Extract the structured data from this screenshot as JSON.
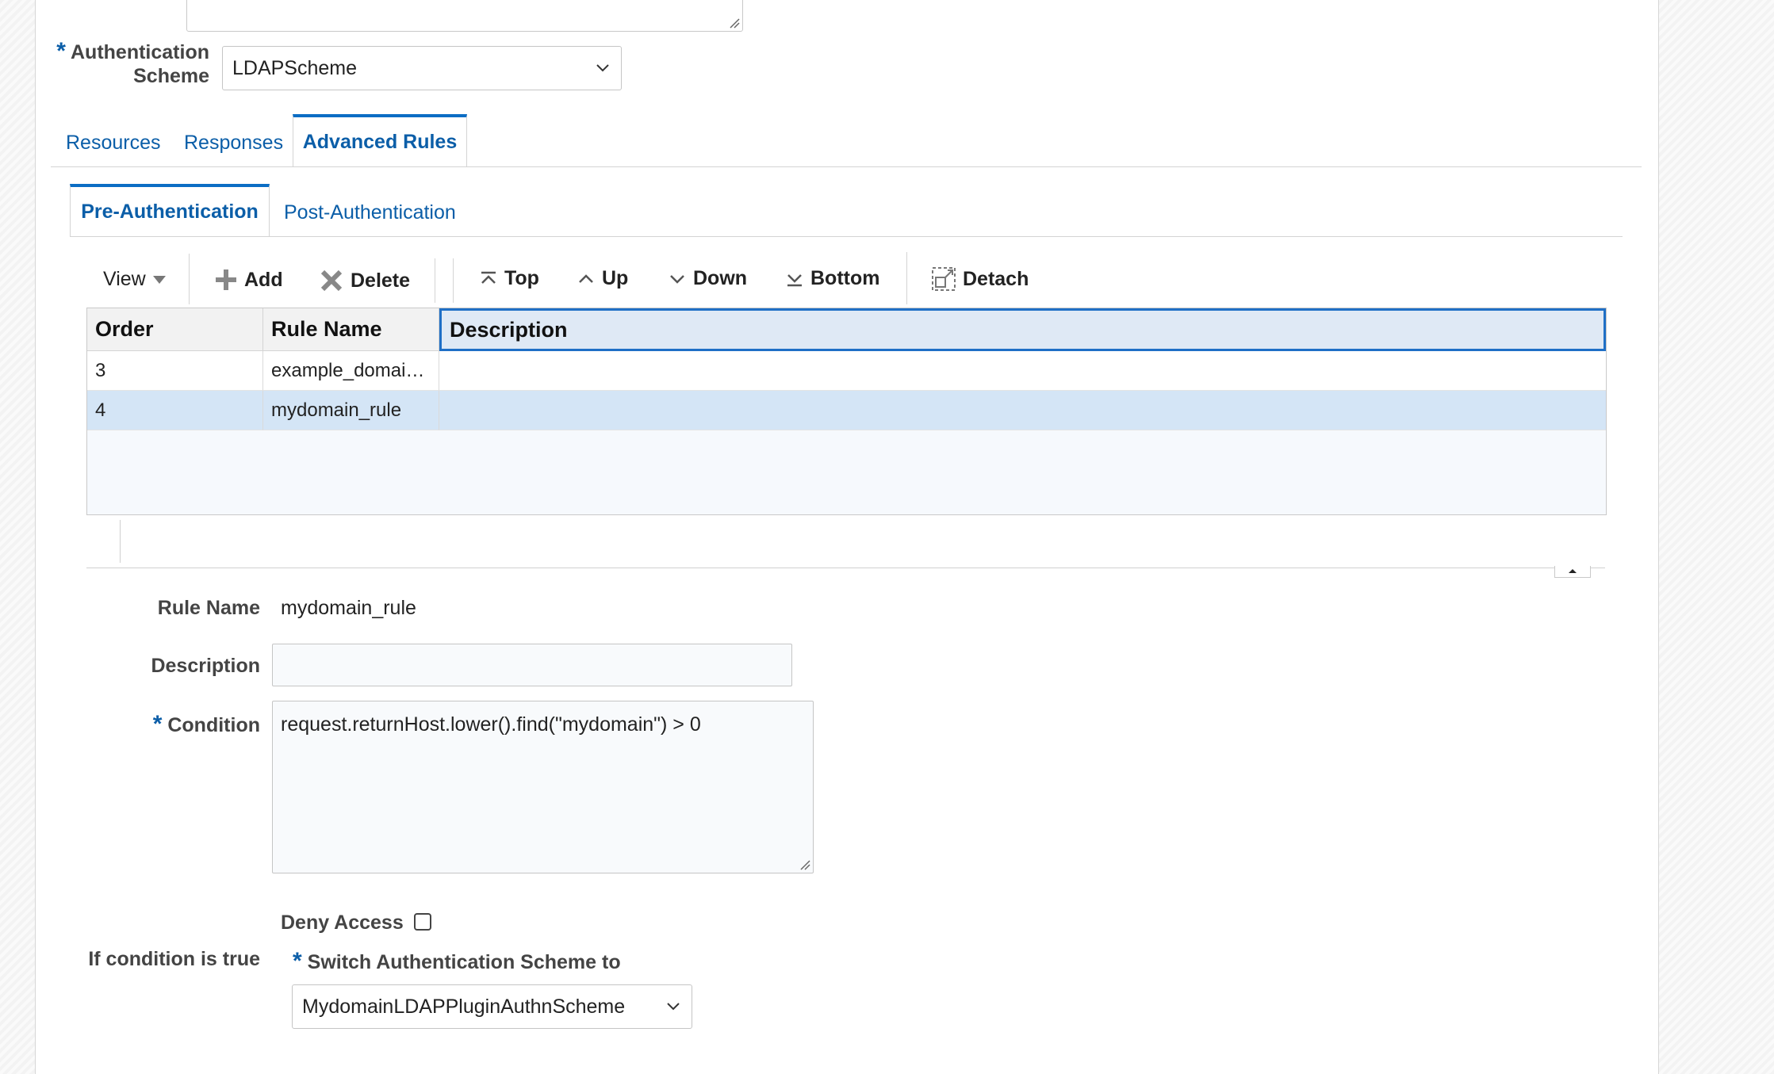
{
  "auth_scheme": {
    "label": "Authentication Scheme",
    "label_line1": "Authentication",
    "label_line2": "Scheme",
    "value": "LDAPScheme"
  },
  "main_tabs": [
    {
      "label": "Resources",
      "active": false
    },
    {
      "label": "Responses",
      "active": false
    },
    {
      "label": "Advanced Rules",
      "active": true
    }
  ],
  "sub_tabs": [
    {
      "label": "Pre-Authentication",
      "active": true
    },
    {
      "label": "Post-Authentication",
      "active": false
    }
  ],
  "toolbar": {
    "view": "View",
    "add": "Add",
    "delete": "Delete",
    "top": "Top",
    "up": "Up",
    "down": "Down",
    "bottom": "Bottom",
    "detach": "Detach"
  },
  "table": {
    "columns": [
      "Order",
      "Rule Name",
      "Description"
    ],
    "rows": [
      {
        "order": "3",
        "rule_name": "example_domai…",
        "description": "",
        "selected": false
      },
      {
        "order": "4",
        "rule_name": "mydomain_rule",
        "description": "",
        "selected": true
      }
    ]
  },
  "detail": {
    "rule_name_label": "Rule Name",
    "rule_name_value": "mydomain_rule",
    "description_label": "Description",
    "description_value": "",
    "condition_label": "Condition",
    "condition_value": "request.returnHost.lower().find(\"mydomain\") > 0",
    "if_true_label": "If condition is true",
    "deny_access_label": "Deny Access",
    "deny_access_checked": false,
    "switch_label": "Switch Authentication Scheme to",
    "switch_value": "MydomainLDAPPluginAuthnScheme"
  },
  "colors": {
    "accent": "#0b6dc4",
    "link": "#0b5ea8",
    "selected_row": "#d4e5f6",
    "header_selected": "#dfe9f5"
  }
}
